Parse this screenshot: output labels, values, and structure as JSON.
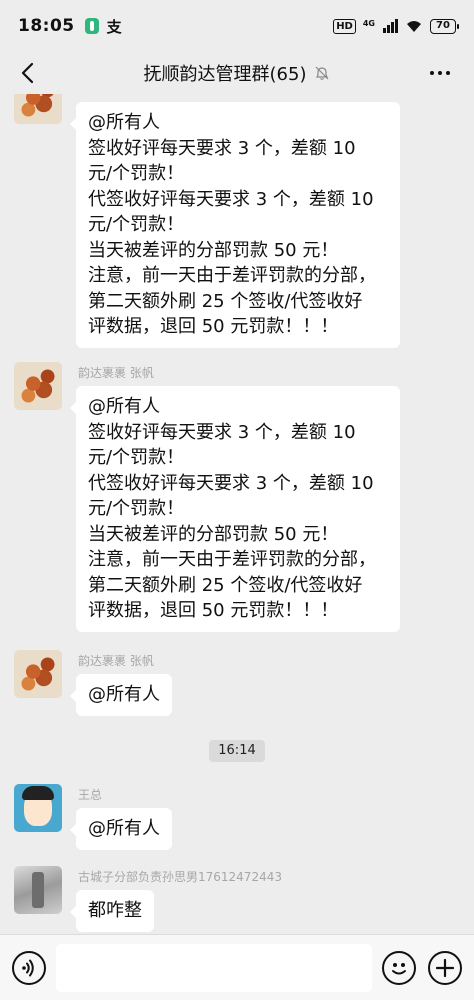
{
  "status_bar": {
    "time": "18:05",
    "app_glyph": "支",
    "hd_label": "HD",
    "signal_label": "4G",
    "battery": "70"
  },
  "header": {
    "title": "抚顺韵达管理群(65)"
  },
  "messages": [
    {
      "sender": "",
      "avatar": "food-photo",
      "lines": [
        "@所有人",
        "签收好评每天要求 3 个，差额 10",
        "元/个罚款！",
        "代签收好评每天要求 3 个，差额 10",
        "元/个罚款！",
        "当天被差评的分部罚款 50 元！",
        "注意，前一天由于差评罚款的分部，",
        "第二天额外刷 25 个签收/代签收好",
        "评数据，退回 50 元罚款！！！"
      ]
    },
    {
      "sender": "韵达裹裹 张帆",
      "avatar": "food-photo",
      "lines": [
        "@所有人",
        "签收好评每天要求 3 个，差额 10",
        "元/个罚款！",
        "代签收好评每天要求 3 个，差额 10",
        "元/个罚款！",
        "当天被差评的分部罚款 50 元！",
        "注意，前一天由于差评罚款的分部，",
        "第二天额外刷 25 个签收/代签收好",
        "评数据，退回 50 元罚款！！！"
      ]
    },
    {
      "sender": "韵达裹裹 张帆",
      "avatar": "food-photo",
      "text": "@所有人"
    },
    {
      "sender": "王总",
      "avatar": "cartoon-person",
      "text": "@所有人"
    },
    {
      "sender": "古城子分部负责孙思男17612472443",
      "avatar": "grey-photo",
      "text": "都咋整"
    }
  ],
  "time_divider": "16:14",
  "input": {
    "value": ""
  },
  "icons": {
    "back": "chevron-left-icon",
    "mute": "bell-off-icon",
    "more": "more-dots-icon",
    "voice": "voice-icon",
    "emoji": "emoji-icon",
    "plus": "plus-icon"
  }
}
